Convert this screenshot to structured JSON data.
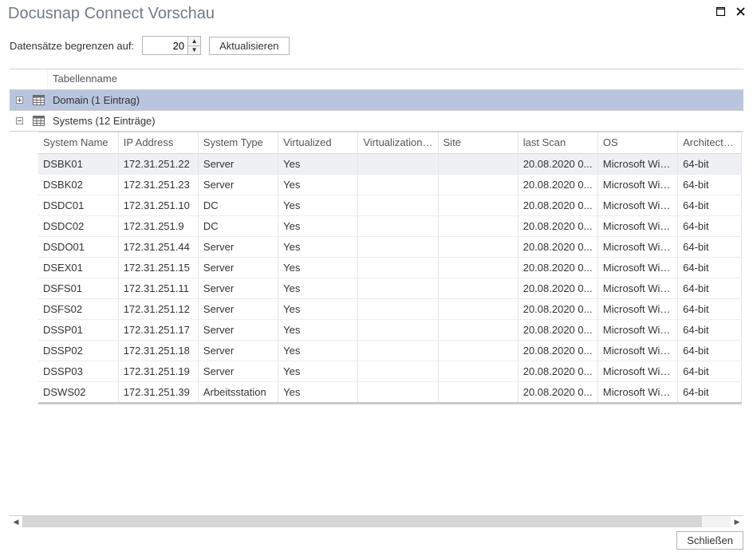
{
  "window": {
    "title": "Docusnap Connect Vorschau"
  },
  "toolbar": {
    "limit_label": "Datensätze begrenzen auf:",
    "limit_value": "20",
    "refresh_label": "Aktualisieren"
  },
  "outerHeader": {
    "tableName": "Tabellenname"
  },
  "groups": {
    "domain": {
      "label": "Domain (1 Eintrag)",
      "expanded": false
    },
    "systems": {
      "label": "Systems (12 Einträge)",
      "expanded": true
    }
  },
  "systemsTable": {
    "columns": [
      "System Name",
      "IP Address",
      "System Type",
      "Virtualized",
      "Virtualization H...",
      "Site",
      "last Scan",
      "OS",
      "Architecture"
    ],
    "rows": [
      {
        "name": "DSBK01",
        "ip": "172.31.251.22",
        "type": "Server",
        "virt": "Yes",
        "vhost": "",
        "site": "",
        "scan": "20.08.2020 0...",
        "os": "Microsoft Win...",
        "arch": "64-bit",
        "selected": true
      },
      {
        "name": "DSBK02",
        "ip": "172.31.251.23",
        "type": "Server",
        "virt": "Yes",
        "vhost": "",
        "site": "",
        "scan": "20.08.2020 0...",
        "os": "Microsoft Win...",
        "arch": "64-bit"
      },
      {
        "name": "DSDC01",
        "ip": "172.31.251.10",
        "type": "DC",
        "virt": "Yes",
        "vhost": "",
        "site": "",
        "scan": "20.08.2020 0...",
        "os": "Microsoft Win...",
        "arch": "64-bit"
      },
      {
        "name": "DSDC02",
        "ip": "172.31.251.9",
        "type": "DC",
        "virt": "Yes",
        "vhost": "",
        "site": "",
        "scan": "20.08.2020 0...",
        "os": "Microsoft Win...",
        "arch": "64-bit"
      },
      {
        "name": "DSDO01",
        "ip": "172.31.251.44",
        "type": "Server",
        "virt": "Yes",
        "vhost": "",
        "site": "",
        "scan": "20.08.2020 0...",
        "os": "Microsoft Win...",
        "arch": "64-bit"
      },
      {
        "name": "DSEX01",
        "ip": "172.31.251.15",
        "type": "Server",
        "virt": "Yes",
        "vhost": "",
        "site": "",
        "scan": "20.08.2020 0...",
        "os": "Microsoft Win...",
        "arch": "64-bit"
      },
      {
        "name": "DSFS01",
        "ip": "172.31.251.11",
        "type": "Server",
        "virt": "Yes",
        "vhost": "",
        "site": "",
        "scan": "20.08.2020 0...",
        "os": "Microsoft Win...",
        "arch": "64-bit"
      },
      {
        "name": "DSFS02",
        "ip": "172.31.251.12",
        "type": "Server",
        "virt": "Yes",
        "vhost": "",
        "site": "",
        "scan": "20.08.2020 0...",
        "os": "Microsoft Win...",
        "arch": "64-bit"
      },
      {
        "name": "DSSP01",
        "ip": "172.31.251.17",
        "type": "Server",
        "virt": "Yes",
        "vhost": "",
        "site": "",
        "scan": "20.08.2020 0...",
        "os": "Microsoft Win...",
        "arch": "64-bit"
      },
      {
        "name": "DSSP02",
        "ip": "172.31.251.18",
        "type": "Server",
        "virt": "Yes",
        "vhost": "",
        "site": "",
        "scan": "20.08.2020 0...",
        "os": "Microsoft Win...",
        "arch": "64-bit"
      },
      {
        "name": "DSSP03",
        "ip": "172.31.251.19",
        "type": "Server",
        "virt": "Yes",
        "vhost": "",
        "site": "",
        "scan": "20.08.2020 0...",
        "os": "Microsoft Win...",
        "arch": "64-bit"
      },
      {
        "name": "DSWS02",
        "ip": "172.31.251.39",
        "type": "Arbeitsstation",
        "virt": "Yes",
        "vhost": "",
        "site": "",
        "scan": "20.08.2020 0...",
        "os": "Microsoft Win...",
        "arch": "64-bit"
      }
    ]
  },
  "footer": {
    "close_label": "Schließen"
  }
}
